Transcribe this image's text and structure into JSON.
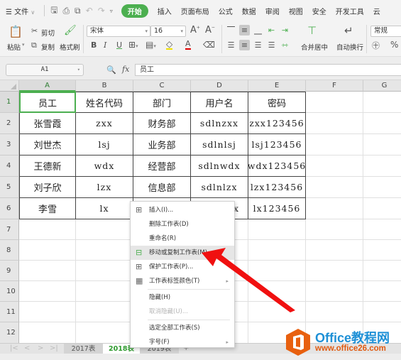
{
  "menubar": {
    "menu_icon": "hamburger-icon",
    "file_label": "文件",
    "quick_access": [
      "save-icon",
      "print-icon",
      "print-preview-icon",
      "undo-icon",
      "redo-icon",
      "customize-icon"
    ],
    "tabs": [
      "开始",
      "插入",
      "页面布局",
      "公式",
      "数据",
      "审阅",
      "视图",
      "安全",
      "开发工具",
      "云"
    ],
    "active_tab": "开始"
  },
  "ribbon": {
    "paste": "粘贴",
    "cut": "剪切",
    "copy": "复制",
    "format_painter": "格式刷",
    "font_name": "宋体",
    "font_size": "16",
    "bold": "B",
    "italic": "I",
    "underline": "U",
    "merge_center": "合并居中",
    "wrap_text": "自动换行",
    "number_format": "常规",
    "percent": "%"
  },
  "formula_bar": {
    "name_box": "A1",
    "fx": "fx",
    "content": "员工"
  },
  "grid": {
    "columns": [
      "A",
      "B",
      "C",
      "D",
      "E",
      "F",
      "G"
    ],
    "selected_column": "A",
    "rows": [
      "1",
      "2",
      "3",
      "4",
      "5",
      "6",
      "7",
      "8",
      "9",
      "10",
      "11",
      "12"
    ],
    "selected_row": "1",
    "headers": [
      "员工",
      "姓名代码",
      "部门",
      "用户名",
      "密码"
    ],
    "data": [
      [
        "张雪霞",
        "zxx",
        "财务部",
        "sdlnzxx",
        "zxx123456"
      ],
      [
        "刘世杰",
        "lsj",
        "业务部",
        "sdlnlsj",
        "lsj123456"
      ],
      [
        "王德新",
        "wdx",
        "经营部",
        "sdlnwdx",
        "wdx123456"
      ],
      [
        "刘子欣",
        "lzx",
        "信息部",
        "sdlnlzx",
        "lzx123456"
      ],
      [
        "李雪",
        "lx",
        "",
        "x",
        "lx123456"
      ]
    ]
  },
  "sheet_tabs": {
    "tabs": [
      "2017表",
      "2018表",
      "2019表"
    ],
    "active": "2018表",
    "add": "+"
  },
  "context_menu": {
    "items": [
      {
        "label": "插入(I)...",
        "icon": "insert-table-icon",
        "disabled": false,
        "highlighted": false,
        "submenu": false
      },
      {
        "label": "删除工作表(D)",
        "icon": "",
        "disabled": false,
        "highlighted": false,
        "submenu": false
      },
      {
        "label": "重命名(R)",
        "icon": "",
        "disabled": false,
        "highlighted": false,
        "submenu": false
      },
      {
        "label": "移动或复制工作表(M)...",
        "icon": "move-copy-sheet-icon",
        "disabled": false,
        "highlighted": true,
        "submenu": false
      },
      {
        "label": "保护工作表(P)...",
        "icon": "protect-sheet-icon",
        "disabled": false,
        "highlighted": false,
        "submenu": false
      },
      {
        "label": "工作表标签颜色(T)",
        "icon": "tab-color-icon",
        "disabled": false,
        "highlighted": false,
        "submenu": true
      },
      {
        "label": "隐藏(H)",
        "icon": "",
        "disabled": false,
        "highlighted": false,
        "submenu": false
      },
      {
        "label": "取消隐藏(U)...",
        "icon": "",
        "disabled": true,
        "highlighted": false,
        "submenu": false
      },
      {
        "label": "选定全部工作表(S)",
        "icon": "",
        "disabled": false,
        "highlighted": false,
        "submenu": false
      },
      {
        "label": "字号(F)",
        "icon": "",
        "disabled": false,
        "highlighted": false,
        "submenu": true
      }
    ]
  },
  "watermark": {
    "title": "Office教程网",
    "url": "www.office26.com"
  },
  "colors": {
    "accent_green": "#4caf50",
    "arrow_red": "#f01010",
    "watermark_blue": "#1e90d6",
    "watermark_orange": "#e05a10"
  }
}
